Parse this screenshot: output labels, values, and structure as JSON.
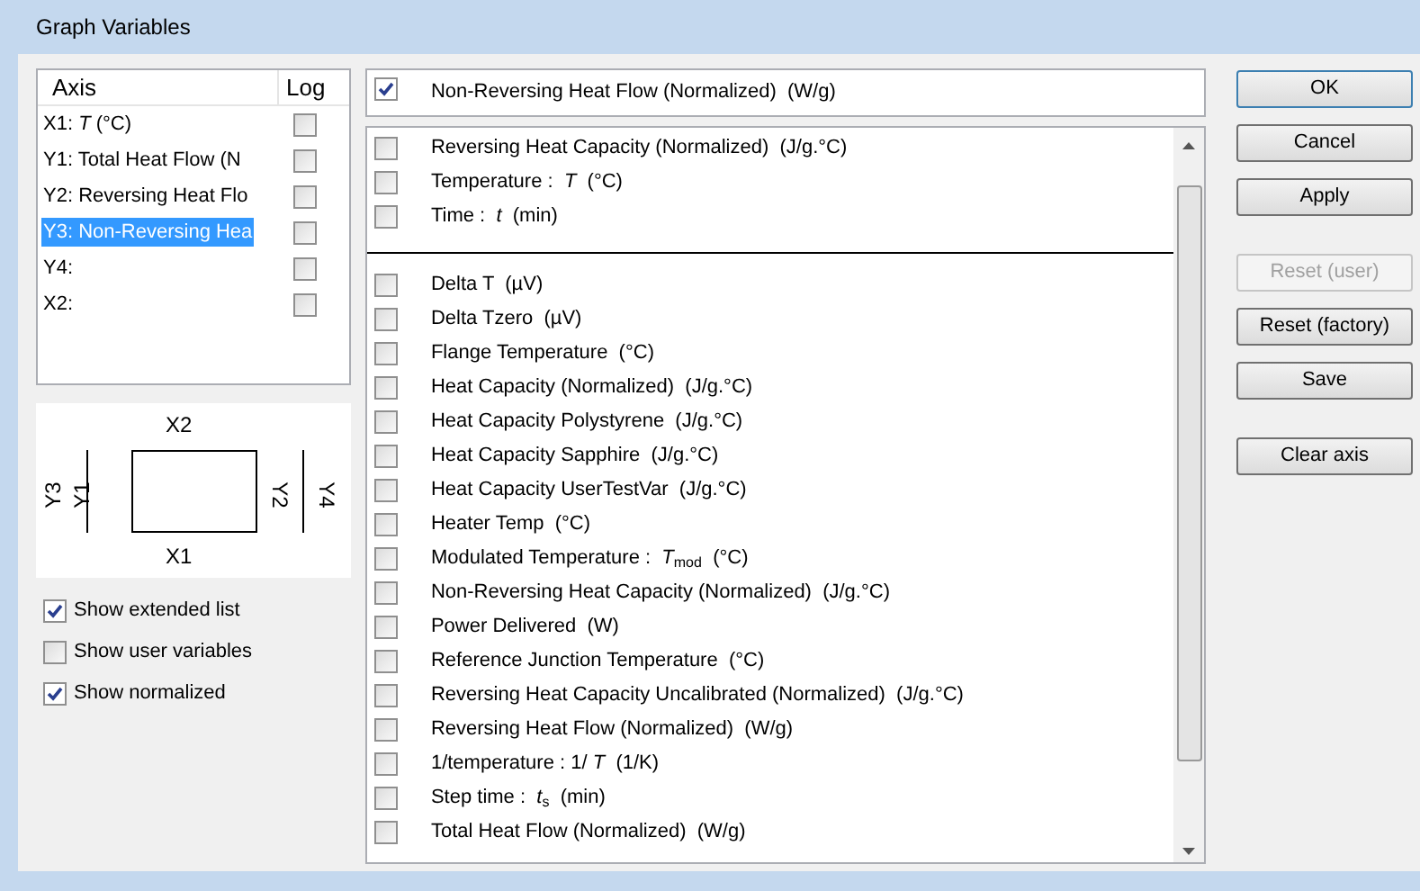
{
  "window": {
    "title": "Graph Variables"
  },
  "axes": {
    "columns": [
      "Axis",
      "Log"
    ],
    "rows": [
      {
        "label": "X1: *T* (°C)",
        "log": false,
        "selected": false
      },
      {
        "label": "Y1: Total Heat Flow (N",
        "log": false,
        "selected": false
      },
      {
        "label": "Y2: Reversing Heat Flo",
        "log": false,
        "selected": false
      },
      {
        "label": "Y3: Non-Reversing Hea",
        "log": false,
        "selected": true
      },
      {
        "label": "Y4:",
        "log": false,
        "selected": false
      },
      {
        "label": "X2:",
        "log": false,
        "selected": false
      }
    ]
  },
  "diagram": {
    "top": "X2",
    "bottom": "X1",
    "left_outer": "Y3",
    "left_inner": "Y1",
    "right_inner": "Y2",
    "right_outer": "Y4"
  },
  "options": [
    {
      "label": "Show extended list",
      "checked": true
    },
    {
      "label": "Show user variables",
      "checked": false
    },
    {
      "label": "Show normalized",
      "checked": true
    }
  ],
  "current_variable": {
    "label": "Non-Reversing Heat Flow (Normalized)  (W/g)",
    "checked": true
  },
  "variable_groups": [
    [
      {
        "label": "Reversing Heat Capacity (Normalized)  (J/g.°C)",
        "checked": false
      },
      {
        "label": "Temperature :  *T*  (°C)",
        "checked": false
      },
      {
        "label": "Time :  *t*  (min)",
        "checked": false
      }
    ],
    [
      {
        "label": "Delta T  (µV)",
        "checked": false
      },
      {
        "label": "Delta Tzero  (µV)",
        "checked": false
      },
      {
        "label": "Flange Temperature  (°C)",
        "checked": false
      },
      {
        "label": "Heat Capacity (Normalized)  (J/g.°C)",
        "checked": false
      },
      {
        "label": "Heat Capacity Polystyrene  (J/g.°C)",
        "checked": false
      },
      {
        "label": "Heat Capacity Sapphire  (J/g.°C)",
        "checked": false
      },
      {
        "label": "Heat Capacity UserTestVar  (J/g.°C)",
        "checked": false
      },
      {
        "label": "Heater Temp  (°C)",
        "checked": false
      },
      {
        "label": "Modulated Temperature :  *T*$_{mod}$  (°C)",
        "checked": false
      },
      {
        "label": "Non-Reversing Heat Capacity (Normalized)  (J/g.°C)",
        "checked": false
      },
      {
        "label": "Power Delivered  (W)",
        "checked": false
      },
      {
        "label": "Reference Junction Temperature  (°C)",
        "checked": false
      },
      {
        "label": "Reversing Heat Capacity Uncalibrated (Normalized)  (J/g.°C)",
        "checked": false
      },
      {
        "label": "Reversing Heat Flow (Normalized)  (W/g)",
        "checked": false
      },
      {
        "label": "1/temperature : 1/ *T*  (1/K)",
        "checked": false
      },
      {
        "label": "Step time :  *t*$_{s}$  (min)",
        "checked": false
      },
      {
        "label": "Total Heat Flow (Normalized)  (W/g)",
        "checked": false
      }
    ]
  ],
  "button_groups": [
    [
      {
        "label": "OK",
        "disabled": false,
        "default": true
      },
      {
        "label": "Cancel",
        "disabled": false,
        "default": false
      },
      {
        "label": "Apply",
        "disabled": false,
        "default": false
      }
    ],
    [
      {
        "label": "Reset (user)",
        "disabled": true,
        "default": false
      },
      {
        "label": "Reset (factory)",
        "disabled": false,
        "default": false
      },
      {
        "label": "Save",
        "disabled": false,
        "default": false
      }
    ],
    [
      {
        "label": "Clear axis",
        "disabled": false,
        "default": false
      }
    ]
  ]
}
